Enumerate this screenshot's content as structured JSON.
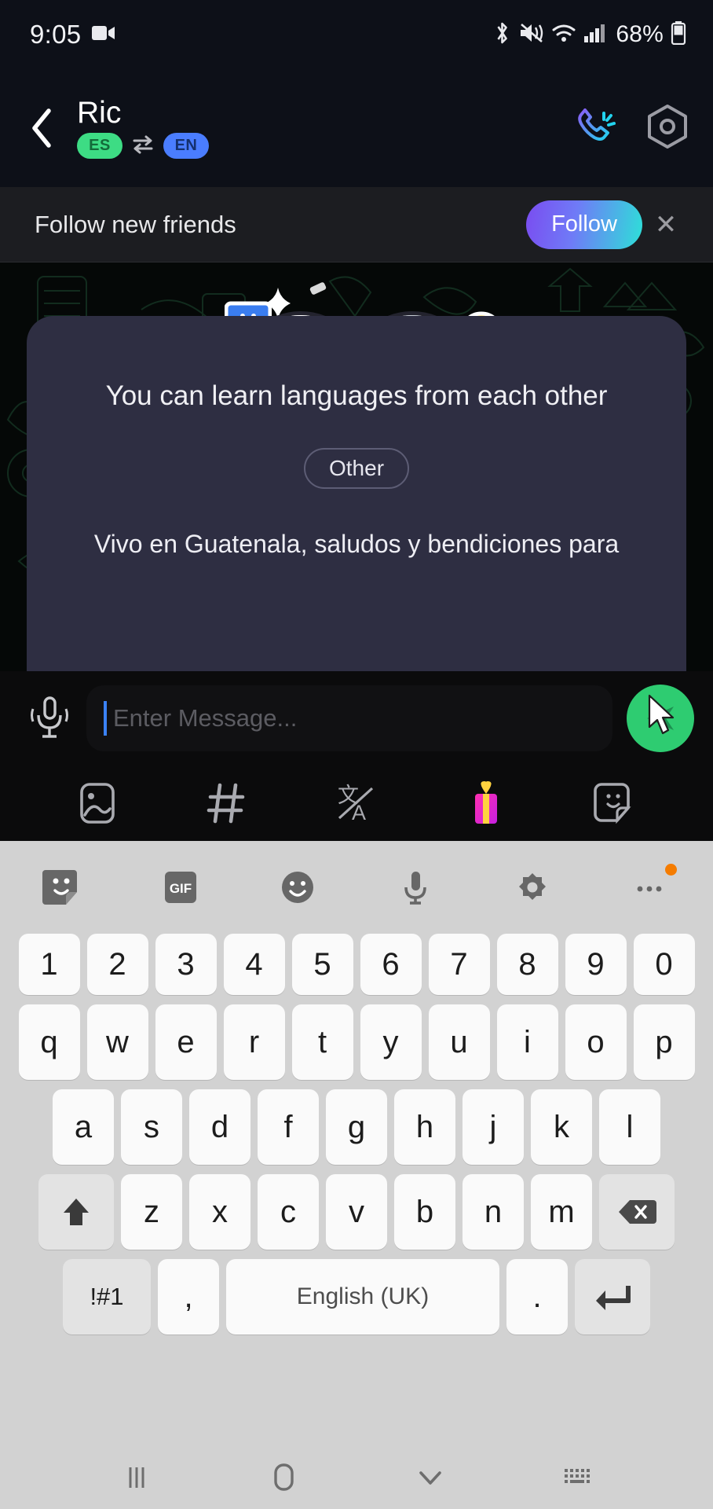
{
  "status_bar": {
    "time": "9:05",
    "battery_percent": "68%",
    "icons": [
      "video-recording-icon",
      "bluetooth-icon",
      "mute-icon",
      "wifi-icon",
      "cellular-signal-icon",
      "battery-icon"
    ]
  },
  "header": {
    "back_label": "back-arrow",
    "contact_name": "Ric",
    "lang_from": "ES",
    "lang_to": "EN",
    "swap_icon": "swap-arrows-icon",
    "call_icon": "phone-call-icon",
    "settings_icon": "settings-hexagon-icon",
    "colors": {
      "lang_from_bg": "#3ddc84",
      "lang_to_bg": "#4a7dff"
    }
  },
  "follow_banner": {
    "text": "Follow new friends",
    "button_label": "Follow",
    "close_label": "✕",
    "gradient_start": "#7a4cf0",
    "gradient_end": "#2de0d8"
  },
  "chat": {
    "intro_title": "You can learn languages from each other",
    "category_pill": "Other",
    "message_text": "Vivo  en Guatenala,  saludos y bendiciones para",
    "avatar_left_flag": "guatemala-flag",
    "avatar_right_flag": "usa-flag",
    "card_bg": "#2e2e42"
  },
  "input_bar": {
    "mic_icon": "microphone-icon",
    "placeholder": "Enter Message...",
    "value": "",
    "send_icon": "send-icon",
    "send_bg": "#2ecc71",
    "tools": [
      {
        "name": "gallery-icon",
        "label": "image"
      },
      {
        "name": "hashtag-icon",
        "label": "#"
      },
      {
        "name": "translate-icon",
        "label": "translate"
      },
      {
        "name": "gift-icon",
        "label": "gift"
      },
      {
        "name": "sticker-icon",
        "label": "sticker"
      }
    ]
  },
  "keyboard": {
    "toolbar": [
      {
        "name": "sticker-toolbar-icon"
      },
      {
        "name": "gif-icon",
        "label": "GIF"
      },
      {
        "name": "emoji-icon"
      },
      {
        "name": "voice-input-icon"
      },
      {
        "name": "keyboard-settings-icon"
      },
      {
        "name": "more-options-icon"
      }
    ],
    "row_numbers": [
      "1",
      "2",
      "3",
      "4",
      "5",
      "6",
      "7",
      "8",
      "9",
      "0"
    ],
    "row_top": [
      "q",
      "w",
      "e",
      "r",
      "t",
      "y",
      "u",
      "i",
      "o",
      "p"
    ],
    "row_home": [
      "a",
      "s",
      "d",
      "f",
      "g",
      "h",
      "j",
      "k",
      "l"
    ],
    "row_bottom": [
      "z",
      "x",
      "c",
      "v",
      "b",
      "n",
      "m"
    ],
    "shift_label": "↑",
    "backspace_label": "⌫",
    "symbols_label": "!#1",
    "comma_label": ",",
    "space_label": "English (UK)",
    "period_label": ".",
    "enter_label": "↵"
  },
  "navbar": {
    "recents_icon": "recents-icon",
    "home_icon": "home-icon",
    "back_icon": "hide-keyboard-chevron-icon",
    "keyboard_icon": "keyboard-switch-icon"
  }
}
